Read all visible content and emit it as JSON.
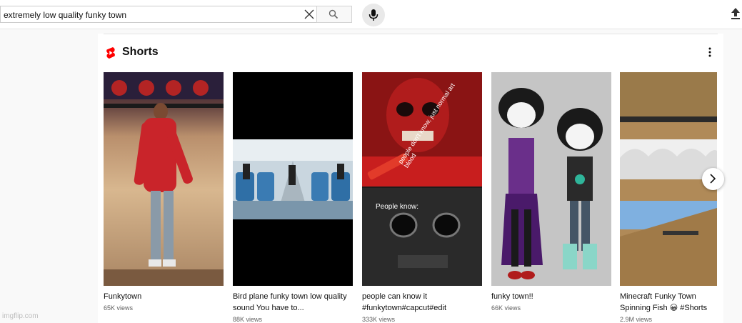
{
  "search": {
    "query": "extremely low quality funky town"
  },
  "section": {
    "title": "Shorts"
  },
  "shorts": [
    {
      "title": "Funkytown",
      "views": "65K views"
    },
    {
      "title": "Bird plane funky town low quality sound You have to...",
      "views": "88K views"
    },
    {
      "title": "people can know it #funkytown#capcut#edit",
      "views": "333K views",
      "overlay_top": "people don't know, just normal art blood",
      "overlay_bottom": "People know:"
    },
    {
      "title": "funky town!!",
      "views": "66K views"
    },
    {
      "title": "Minecraft Funky Town Spinning Fish 😀 #Shorts",
      "views": "2.9M views"
    }
  ],
  "watermark": "imgflip.com",
  "colors": {
    "shorts_red": "#ff0000",
    "views_gray": "#606060"
  },
  "icons": [
    "clear-icon",
    "search-icon",
    "mic-icon",
    "upload-icon",
    "shorts-logo-icon",
    "more-vert-icon",
    "chevron-right-icon"
  ]
}
